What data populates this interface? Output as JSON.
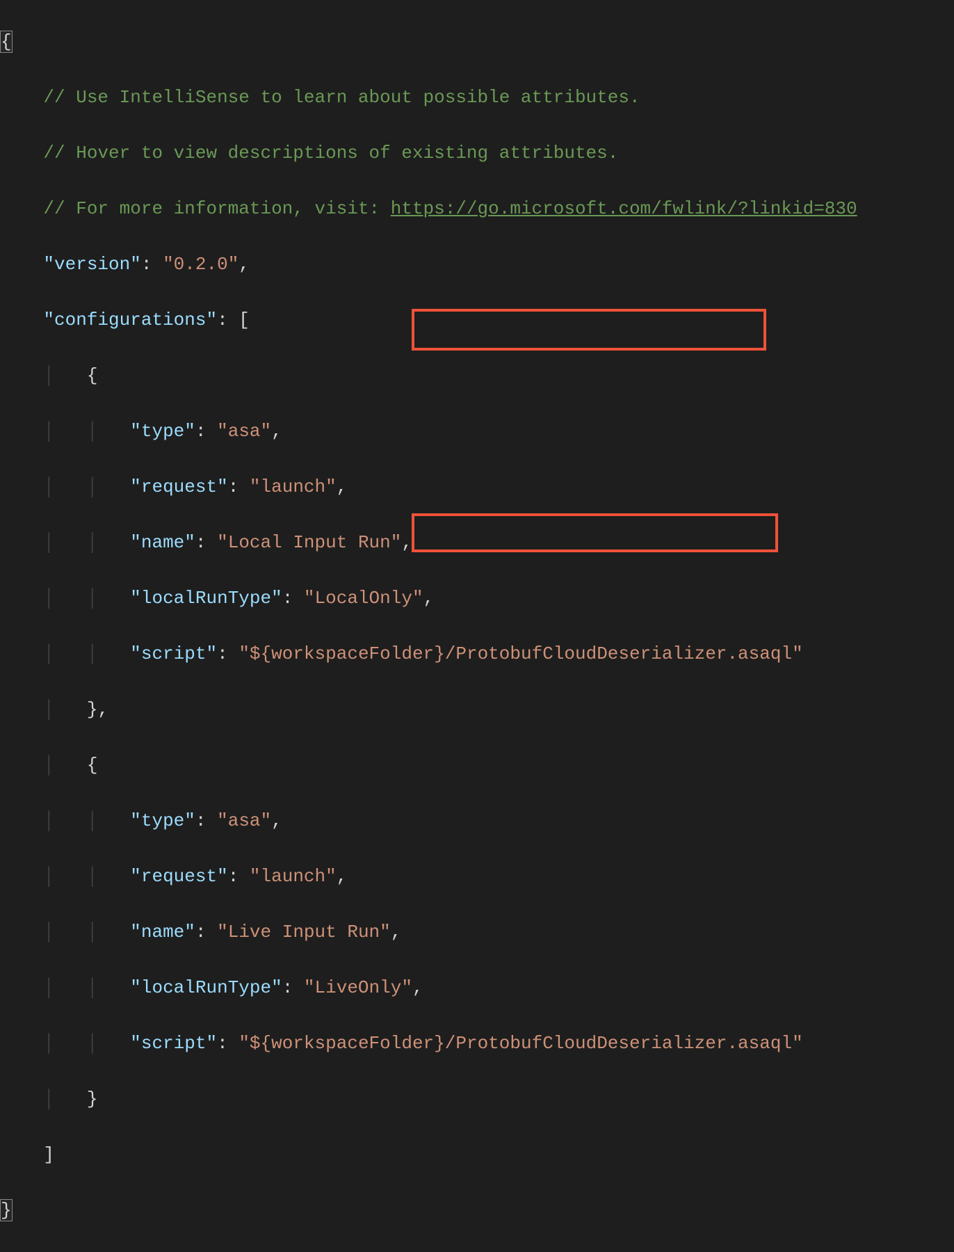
{
  "colors": {
    "background": "#1e1e1e",
    "comment": "#6a9955",
    "key": "#9cdcfe",
    "string": "#ce9178",
    "highlightBorder": "#ef5239"
  },
  "code": {
    "openBrace": "{",
    "comment1": "// Use IntelliSense to learn about possible attributes.",
    "comment2": "// Hover to view descriptions of existing attributes.",
    "comment3_prefix": "// For more information, visit: ",
    "comment3_link": "https://go.microsoft.com/fwlink/?linkid=830",
    "versionKey": "\"version\"",
    "versionVal": "\"0.2.0\"",
    "configurationsKey": "\"configurations\"",
    "openBracket": "[",
    "openObj": "{",
    "typeKey": "\"type\"",
    "typeVal": "\"asa\"",
    "requestKey": "\"request\"",
    "requestVal": "\"launch\"",
    "nameKey": "\"name\"",
    "nameVal1": "\"Local Input Run\"",
    "localRunTypeKey": "\"localRunType\"",
    "localRunTypeVal1": "\"LocalOnly\"",
    "scriptKey": "\"script\"",
    "scriptValPrefix": "\"${workspaceFolder}/",
    "scriptValHighlight": "ProtobufCloudDeserializer.asaql",
    "scriptValSuffix": "\"",
    "closeObjComma": "},",
    "nameVal2": "\"Live Input Run\"",
    "localRunTypeVal2": "\"LiveOnly\"",
    "closeObj": "}",
    "closeBracket": "]",
    "closeBrace": "}"
  }
}
